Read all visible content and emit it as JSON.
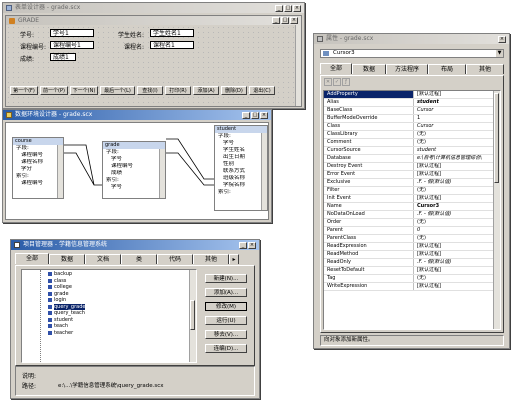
{
  "form_designer": {
    "title": "表单设计器 - grade.scx",
    "form_caption": "GRADE",
    "labels": {
      "xuehao": "学号:",
      "xingming": "学生姓名:",
      "kecheng": "课程编号:",
      "kcm": "课程名:",
      "chengji": "成绩:"
    },
    "fields": {
      "xuehao": "学号1",
      "xingming": "学生姓名1",
      "kecheng": "课程编号1",
      "kcm": "课程名1",
      "chengji": "成绩1"
    },
    "nav_buttons": [
      "第一个(F)",
      "前一个(P)",
      "下一个(N)",
      "最后一个(L)",
      "查找(I)",
      "打印(R)",
      "添加(A)",
      "删除(D)",
      "退出(C)"
    ]
  },
  "data_env": {
    "title": "数据环境设计器 - grade.scx",
    "tables": [
      {
        "name": "course",
        "fields": [
          "字段:",
          "课程编号",
          "课程名称",
          "学分",
          "索引:",
          "课程编号"
        ]
      },
      {
        "name": "grade",
        "fields": [
          "字段:",
          "学号",
          "课程编号",
          "成绩",
          "索引:",
          "学号"
        ]
      },
      {
        "name": "student",
        "fields": [
          "字段:",
          "学号",
          "学生姓名",
          "出生日期",
          "性别",
          "联系方式",
          "班级名称",
          "学院名称",
          "索引:"
        ]
      }
    ]
  },
  "project": {
    "title": "项目管理器 - 学籍信息管理系统",
    "tabs": [
      "全部",
      "数据",
      "文档",
      "类",
      "代码",
      "其他"
    ],
    "items": [
      "backup",
      "class",
      "college",
      "grade",
      "login",
      "query_grade",
      "query_teach",
      "student",
      "teach",
      "teacher"
    ],
    "selected": "query_grade",
    "buttons": [
      "新建(N)...",
      "添加(A)...",
      "修改(M)",
      "运行(U)",
      "移去(V)...",
      "连编(D)..."
    ],
    "desc_label": "说明:",
    "path_label": "路径:",
    "path_value": "e:\\...\\学籍信息管理系统\\query_grade.scx"
  },
  "properties": {
    "title": "属性 - grade.scx",
    "object": "Cursor3",
    "tabs": [
      "全部",
      "数据",
      "方法程序",
      "布局",
      "其他"
    ],
    "rows": [
      [
        "AddProperty",
        "[默认过程]"
      ],
      [
        "Alias",
        "student"
      ],
      [
        "BaseClass",
        "Cursor"
      ],
      [
        "BufferModeOverride",
        "1"
      ],
      [
        "Class",
        "Cursor"
      ],
      [
        "ClassLibrary",
        "(无)"
      ],
      [
        "Comment",
        "(无)"
      ],
      [
        "CursorSource",
        "student"
      ],
      [
        "Database",
        "e:\\自考\\计算机信息管理综合\\"
      ],
      [
        "Destroy Event",
        "[默认过程]"
      ],
      [
        "Error Event",
        "[默认过程]"
      ],
      [
        "Exclusive",
        ".F. - 假(默认值)"
      ],
      [
        "Filter",
        "(无)"
      ],
      [
        "Init Event",
        "[默认过程]"
      ],
      [
        "Name",
        "Cursor3"
      ],
      [
        "NoDataOnLoad",
        ".F. - 假(默认值)"
      ],
      [
        "Order",
        "(无)"
      ],
      [
        "Parent",
        "0"
      ],
      [
        "ParentClass",
        "(无)"
      ],
      [
        "ReadExpression",
        "[默认过程]"
      ],
      [
        "ReadMethod",
        "[默认过程]"
      ],
      [
        "ReadOnly",
        ".F. - 假(默认值)"
      ],
      [
        "ResetToDefault",
        "[默认过程]"
      ],
      [
        "Tag",
        "(无)"
      ],
      [
        "WriteExpression",
        "[默认过程]"
      ]
    ],
    "status": "向对象添加新属性。"
  },
  "colors": {
    "active_title": "#2a5ca8",
    "selection": "#0a246a",
    "window_bg": "#d4d0c8"
  }
}
